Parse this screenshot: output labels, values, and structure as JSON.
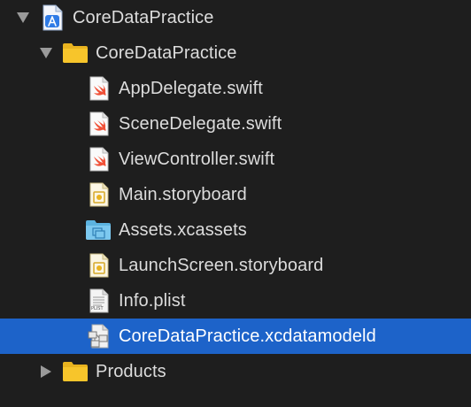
{
  "tree": {
    "project": {
      "label": "CoreDataPractice",
      "icon": "xcode-project-icon",
      "expanded": true
    },
    "group": {
      "label": "CoreDataPractice",
      "icon": "folder-icon",
      "expanded": true
    },
    "files": [
      {
        "label": "AppDelegate.swift",
        "icon": "swift-file-icon"
      },
      {
        "label": "SceneDelegate.swift",
        "icon": "swift-file-icon"
      },
      {
        "label": "ViewController.swift",
        "icon": "swift-file-icon"
      },
      {
        "label": "Main.storyboard",
        "icon": "storyboard-file-icon"
      },
      {
        "label": "Assets.xcassets",
        "icon": "asset-catalog-folder-icon"
      },
      {
        "label": "LaunchScreen.storyboard",
        "icon": "storyboard-file-icon"
      },
      {
        "label": "Info.plist",
        "icon": "plist-file-icon",
        "badge": "PLIST"
      },
      {
        "label": "CoreDataPractice.xcdatamodeld",
        "icon": "data-model-file-icon",
        "selected": true
      }
    ],
    "products": {
      "label": "Products",
      "icon": "folder-icon",
      "expanded": false
    }
  },
  "colors": {
    "background": "#1e1e1e",
    "selection": "#1d63c9",
    "folder": "#f7c52b",
    "swift": "#f05138",
    "text": "#dcdcdc"
  }
}
